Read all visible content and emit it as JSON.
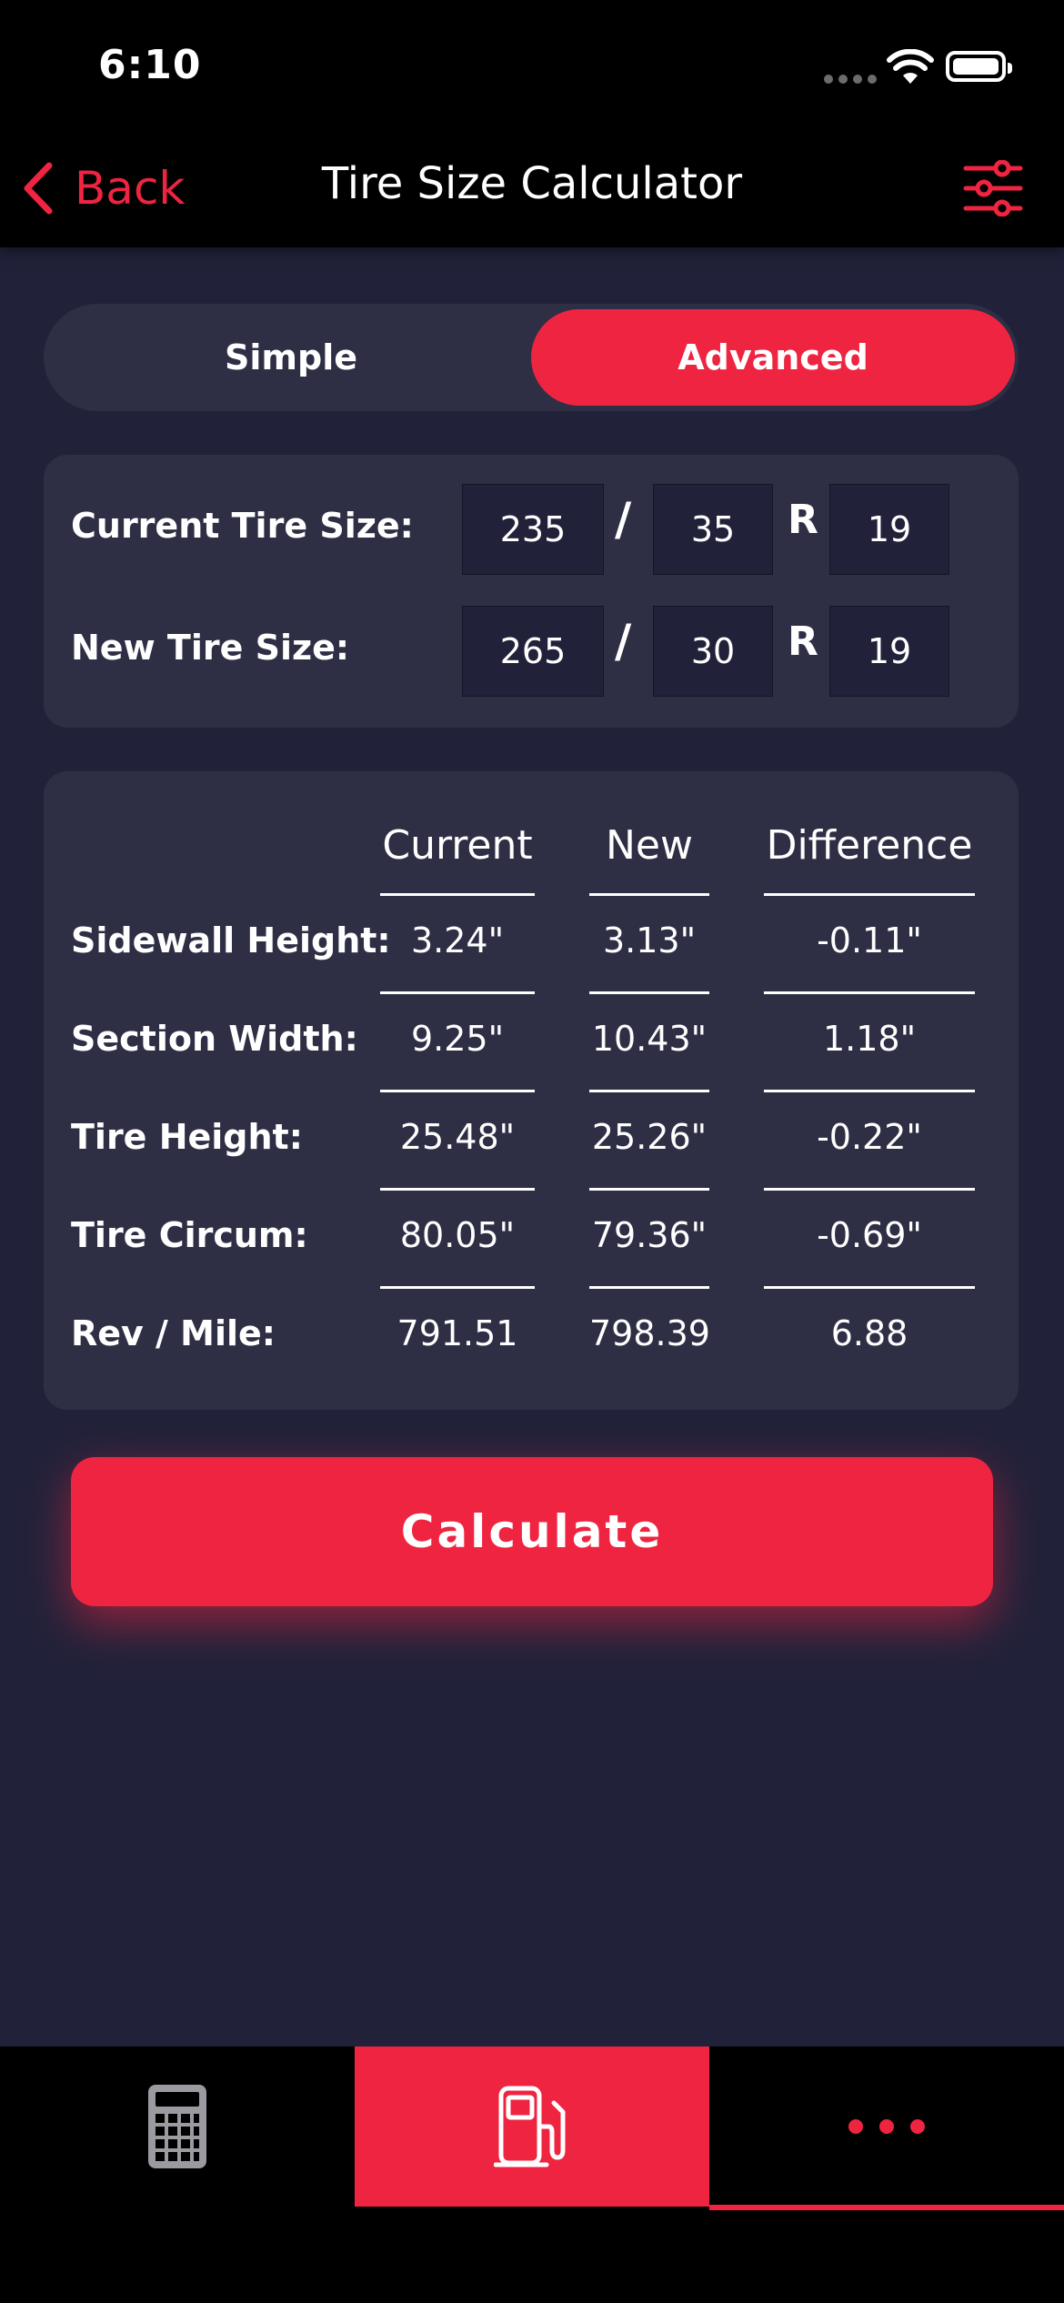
{
  "status": {
    "time": "6:10"
  },
  "nav": {
    "back_label": "Back",
    "title": "Tire Size Calculator"
  },
  "segment": {
    "options": [
      "Simple",
      "Advanced"
    ],
    "selected": "Advanced"
  },
  "sizes": {
    "current": {
      "label": "Current Tire Size:",
      "width": "235",
      "aspect": "35",
      "rim": "19"
    },
    "new": {
      "label": "New Tire Size:",
      "width": "265",
      "aspect": "30",
      "rim": "19"
    },
    "slash": "/",
    "r": "R"
  },
  "results": {
    "columns": [
      "Current",
      "New",
      "Difference"
    ],
    "rows": [
      {
        "label": "Sidewall Height:",
        "current": "3.24\"",
        "new": "3.13\"",
        "diff": "-0.11\""
      },
      {
        "label": "Section Width:",
        "current": "9.25\"",
        "new": "10.43\"",
        "diff": "1.18\""
      },
      {
        "label": "Tire Height:",
        "current": "25.48\"",
        "new": "25.26\"",
        "diff": "-0.22\""
      },
      {
        "label": "Tire Circum:",
        "current": "80.05\"",
        "new": "79.36\"",
        "diff": "-0.69\""
      },
      {
        "label": "Rev / Mile:",
        "current": "791.51",
        "new": "798.39",
        "diff": "6.88"
      }
    ]
  },
  "calculate_label": "Calculate",
  "tabs": [
    {
      "icon": "calculator-icon"
    },
    {
      "icon": "fuel-pump-icon"
    },
    {
      "icon": "more-dots-icon"
    }
  ],
  "colors": {
    "accent": "#ef2440",
    "background": "#21223a",
    "card": "#2e2f45"
  }
}
